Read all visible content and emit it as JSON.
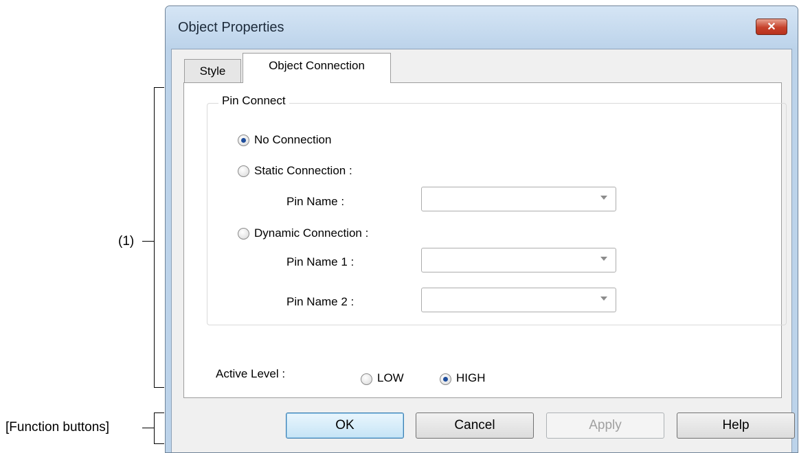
{
  "annotations": {
    "section_1": "(1)",
    "function_buttons": "[Function buttons]"
  },
  "dialog": {
    "title": "Object Properties",
    "close_glyph": "✕"
  },
  "tabs": [
    {
      "label": "Style",
      "active": false
    },
    {
      "label": "Object Connection",
      "active": true
    }
  ],
  "pin_connect": {
    "group_label": "Pin Connect",
    "no_connection_label": "No Connection",
    "no_connection_checked": true,
    "static_connection_label": "Static Connection :",
    "static_connection_checked": false,
    "pin_name_label": "Pin Name :",
    "pin_name_value": "",
    "dynamic_connection_label": "Dynamic Connection :",
    "dynamic_connection_checked": false,
    "pin_name_1_label": "Pin Name 1 :",
    "pin_name_1_value": "",
    "pin_name_2_label": "Pin Name 2 :",
    "pin_name_2_value": ""
  },
  "active_level": {
    "label": "Active Level :",
    "low_label": "LOW",
    "low_checked": false,
    "high_label": "HIGH",
    "high_checked": true
  },
  "buttons": {
    "ok": "OK",
    "cancel": "Cancel",
    "apply": "Apply",
    "help": "Help"
  },
  "colors": {
    "frame": "#bcd3ea",
    "close_button": "#c6412b",
    "radio_dot": "#1f4e9c",
    "default_button_border": "#3c7fb1"
  }
}
